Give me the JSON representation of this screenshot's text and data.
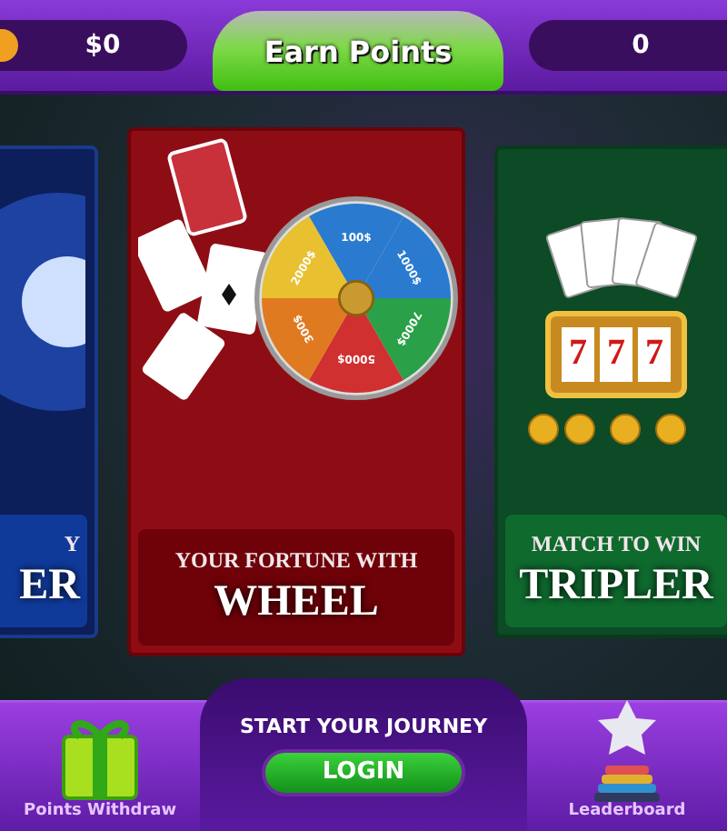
{
  "top_bar": {
    "balance": "$0",
    "title": "Earn Points",
    "points": "0"
  },
  "games": [
    {
      "kind": "partial",
      "subtitle": "Y",
      "title": "ER"
    },
    {
      "kind": "wheel",
      "subtitle": "YOUR FORTUNE WITH",
      "title": "WHEEL",
      "wheel_labels": [
        "100$",
        "1000$",
        "7000$",
        "5000$",
        "300$",
        "2000$"
      ]
    },
    {
      "kind": "slot",
      "subtitle": "MATCH TO WIN",
      "title": "TRIPLER",
      "reels": [
        "7",
        "7",
        "7"
      ]
    }
  ],
  "bottom_bar": {
    "withdraw_label": "Points Withdraw",
    "prompt": "START YOUR JOURNEY",
    "button": "LOGIN",
    "leaderboard_label": "Leaderboard"
  }
}
